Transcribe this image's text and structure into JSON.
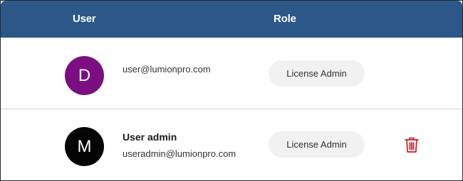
{
  "table": {
    "columns": [
      "User",
      "Role"
    ],
    "rows": [
      {
        "avatar_initial": "D",
        "avatar_color": "#7b0f82",
        "name": "",
        "email": "user@lumionpro.com",
        "role": "License Admin",
        "deletable": false
      },
      {
        "avatar_initial": "M",
        "avatar_color": "#050505",
        "name": "User admin",
        "email": "useradmin@lumionpro.com",
        "role": "License Admin",
        "deletable": true
      }
    ]
  },
  "colors": {
    "header_bg": "#2b5889",
    "delete_icon": "#c8262b"
  },
  "icons": {
    "delete": "trash-icon"
  }
}
